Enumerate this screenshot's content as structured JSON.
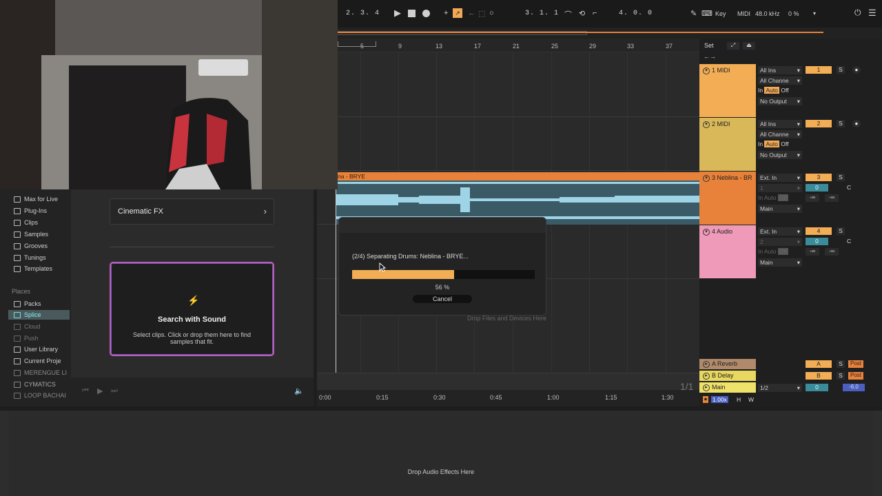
{
  "transport": {
    "position": "2.  3.  4",
    "loop_start": "3.  1.  1",
    "loop_length": "4.  0.  0",
    "key_label": "Key",
    "midi_label": "MIDI",
    "sample_rate": "48.0 kHz",
    "cpu": "0 %"
  },
  "ruler": {
    "bars": [
      "5",
      "9",
      "13",
      "17",
      "21",
      "25",
      "29",
      "33",
      "37"
    ],
    "set_label": "Set"
  },
  "clip": {
    "label": "na - BRYE"
  },
  "drop_files_text": "Drop Files and Devices Here",
  "timeline": {
    "times": [
      "0:00",
      "0:15",
      "0:30",
      "0:45",
      "1:00",
      "1:15",
      "1:30"
    ],
    "page": "1/1"
  },
  "browser": {
    "sidebar": [
      {
        "label": "Max for Live",
        "icon": "max-icon"
      },
      {
        "label": "Plug-Ins",
        "icon": "plugin-icon"
      },
      {
        "label": "Clips",
        "icon": "clip-icon"
      },
      {
        "label": "Samples",
        "icon": "sample-icon"
      },
      {
        "label": "Grooves",
        "icon": "groove-icon"
      },
      {
        "label": "Tunings",
        "icon": "tuning-icon"
      },
      {
        "label": "Templates",
        "icon": "template-icon"
      }
    ],
    "places_header": "Places",
    "places": [
      {
        "label": "Packs"
      },
      {
        "label": "Splice"
      },
      {
        "label": "Cloud"
      },
      {
        "label": "Push"
      },
      {
        "label": "User Library"
      },
      {
        "label": "Current Proje"
      },
      {
        "label": "MERENGUE LI"
      },
      {
        "label": "CYMATICS"
      },
      {
        "label": "LOOP BACHAI"
      }
    ],
    "category_button": "Cinematic FX",
    "search_title": "Search with Sound",
    "search_desc": "Select clips. Click or drop them here to find samples that fit."
  },
  "dialog": {
    "status": "(2/4) Separating Drums: Neblina - BRYE...",
    "progress_fraction": 0.56,
    "progress_text": "56 %",
    "cancel_label": "Cancel"
  },
  "tracks": [
    {
      "name": "1 MIDI",
      "color": "#f2ad55",
      "input": "All Ins",
      "channel": "All Channe",
      "mon": [
        "In",
        "Auto",
        "Off"
      ],
      "output": "No Output",
      "num": "1"
    },
    {
      "name": "2 MIDI",
      "color": "#d9b85a",
      "input": "All Ins",
      "channel": "All Channe",
      "mon": [
        "In",
        "Auto",
        "Off"
      ],
      "output": "No Output",
      "num": "2"
    },
    {
      "name": "3 Neblina - BR",
      "color": "#e8823a",
      "input": "Ext. In",
      "channel": "1",
      "mon": [
        "In",
        "Auto",
        "Off"
      ],
      "output": "Main",
      "num": "3",
      "vol": "0",
      "pan": "C",
      "sends": [
        "-∞",
        "-∞"
      ]
    },
    {
      "name": "4 Audio",
      "color": "#ee9ab8",
      "input": "Ext. In",
      "channel": "2",
      "mon": [
        "In",
        "Auto",
        "Off"
      ],
      "output": "Main",
      "num": "4",
      "vol": "0",
      "pan": "C",
      "sends": [
        "-∞",
        "-∞"
      ]
    }
  ],
  "returns": [
    {
      "name": "A Reverb",
      "color": "#b08a6a",
      "letter": "A",
      "post": "Post"
    },
    {
      "name": "B Delay",
      "color": "#e8d860",
      "letter": "B",
      "post": "Post"
    }
  ],
  "main": {
    "name": "Main",
    "color": "#efe26a",
    "cue": "1/2",
    "vol": "0",
    "db": "-6.0"
  },
  "bottom": {
    "zoom": "1.00x",
    "h": "H",
    "w": "W"
  },
  "device_panel_text": "Drop Audio Effects Here"
}
